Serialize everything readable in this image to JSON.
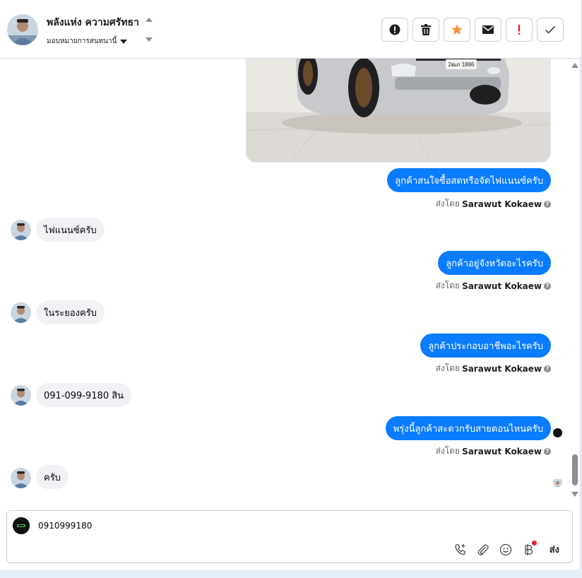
{
  "header": {
    "contact_name": "พลังแห่ง ความศรัทธา",
    "assign_label": "มอบหมายการสนทนานี้"
  },
  "actions": [
    {
      "icon": "alert-circle-icon",
      "color": "#1c1e21"
    },
    {
      "icon": "trash-icon",
      "color": "#1c1e21"
    },
    {
      "icon": "star-icon",
      "color": "#f7923a"
    },
    {
      "icon": "envelope-icon",
      "color": "#1c1e21"
    },
    {
      "icon": "exclamation-icon",
      "color": "#e41e3f"
    },
    {
      "icon": "check-icon",
      "color": "#1c1e21"
    }
  ],
  "messages": [
    {
      "direction": "out",
      "text": "ลูกค้าสนใจซื้อสดหรือจัดไฟแนนซ์ครับ",
      "sent_by_label": "ส่งโดย",
      "sender": "Sarawut Kokaew"
    },
    {
      "direction": "in",
      "text": "ไฟแนนซ์ครับ"
    },
    {
      "direction": "out",
      "text": "ลูกค้าอยู่จังหวัดอะไรครับ",
      "sent_by_label": "ส่งโดย",
      "sender": "Sarawut Kokaew"
    },
    {
      "direction": "in",
      "text": "ในระยองครับ"
    },
    {
      "direction": "out",
      "text": "ลูกค้าประกอบอาชีพอะไรครับ",
      "sent_by_label": "ส่งโดย",
      "sender": "Sarawut Kokaew"
    },
    {
      "direction": "in",
      "text": "091-099-9180 สิน"
    },
    {
      "direction": "out",
      "text": "พรุ่งนี้ลูกค้าสะดวกรับสายตอนไหนครับ",
      "sent_by_label": "ส่งโดย",
      "sender": "Sarawut Kokaew"
    },
    {
      "direction": "in",
      "text": "ครับ"
    }
  ],
  "car_image": {
    "plate": "2ฒภ 1886"
  },
  "composer": {
    "input_value": "0910999180",
    "send_label": "ส่ง",
    "tools": [
      "phone-plus-icon",
      "paperclip-icon",
      "smiley-icon",
      "baht-icon"
    ]
  },
  "colors": {
    "outgoing_bubble": "#0a7cff",
    "incoming_bubble": "#f0f2f5",
    "star": "#f7923a",
    "alert_red": "#e41e3f"
  }
}
